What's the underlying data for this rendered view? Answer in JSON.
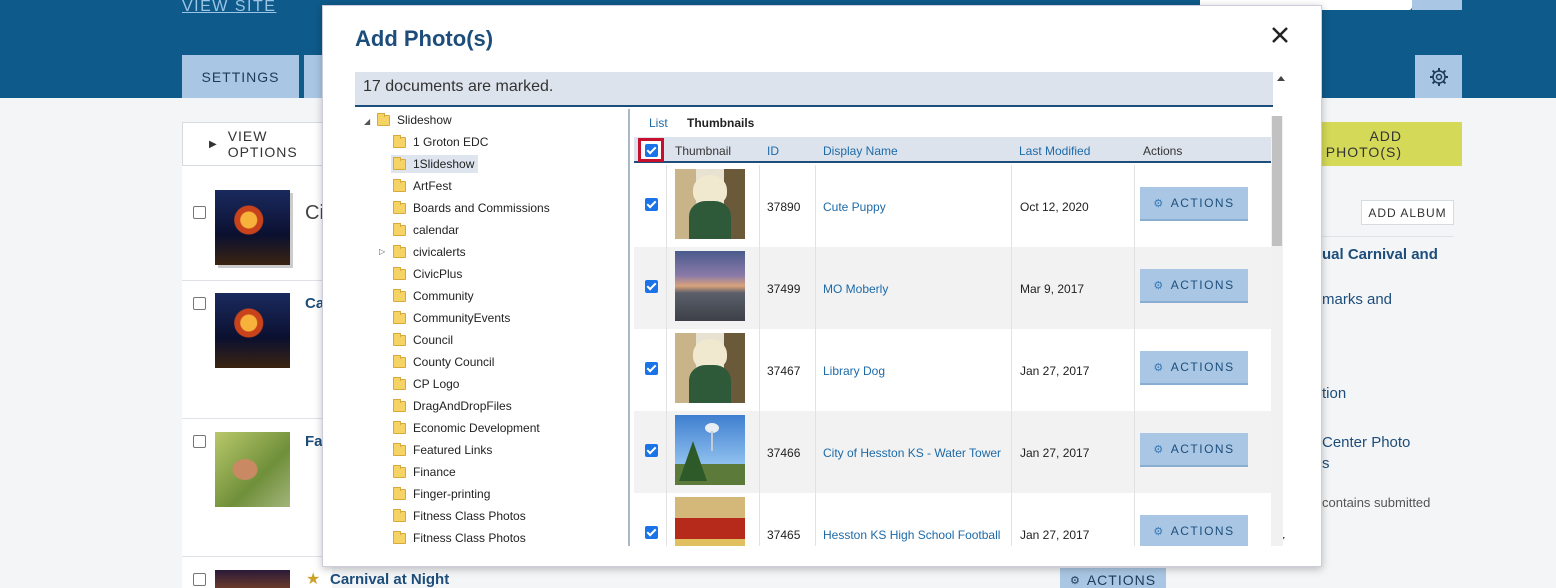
{
  "background": {
    "view_site": "VIEW SITE",
    "tabs": [
      "SETTINGS"
    ],
    "view_options": "VIEW OPTIONS",
    "add_photos": "ADD PHOTO(S)",
    "add_album": "ADD ALBUM",
    "partial_title": "Ci",
    "left_items": [
      {
        "title": "Ca"
      },
      {
        "title": "Fa"
      }
    ],
    "bottom_item_title": "Carnival at Night",
    "bottom_actions": "ACTIONS",
    "right_texts": [
      "ual Carnival and",
      "marks and",
      "tion",
      "Center Photo",
      "s",
      "contains submitted"
    ]
  },
  "modal": {
    "title": "Add Photo(s)",
    "status": "17 documents are marked.",
    "tree": {
      "root": "Slideshow",
      "items": [
        "1 Groton EDC",
        "1Slideshow",
        "ArtFest",
        "Boards and Commissions",
        "calendar",
        "civicalerts",
        "CivicPlus",
        "Community",
        "CommunityEvents",
        "Council",
        "County Council",
        "CP Logo",
        "DragAndDropFiles",
        "Economic Development",
        "Featured Links",
        "Finance",
        "Finger-printing",
        "Fitness Class Photos",
        "Fitness Class Photos"
      ]
    },
    "view_tabs": {
      "list": "List",
      "thumbnails": "Thumbnails"
    },
    "columns": {
      "thumbnail": "Thumbnail",
      "id": "ID",
      "display_name": "Display Name",
      "last_modified": "Last Modified",
      "actions": "Actions"
    },
    "rows": [
      {
        "id": "37890",
        "name": "Cute Puppy",
        "date": "Oct 12, 2020",
        "action": "ACTIONS",
        "thumb": "dog"
      },
      {
        "id": "37499",
        "name": "MO Moberly",
        "date": "Mar 9, 2017",
        "action": "ACTIONS",
        "thumb": "city"
      },
      {
        "id": "37467",
        "name": "Library Dog",
        "date": "Jan 27, 2017",
        "action": "ACTIONS",
        "thumb": "dog"
      },
      {
        "id": "37466",
        "name": "City of Hesston KS - Water Tower",
        "date": "Jan 27, 2017",
        "action": "ACTIONS",
        "thumb": "tower"
      },
      {
        "id": "37465",
        "name": "Hesston KS High School Football",
        "date": "Jan 27, 2017",
        "action": "ACTIONS",
        "thumb": "football"
      }
    ]
  }
}
